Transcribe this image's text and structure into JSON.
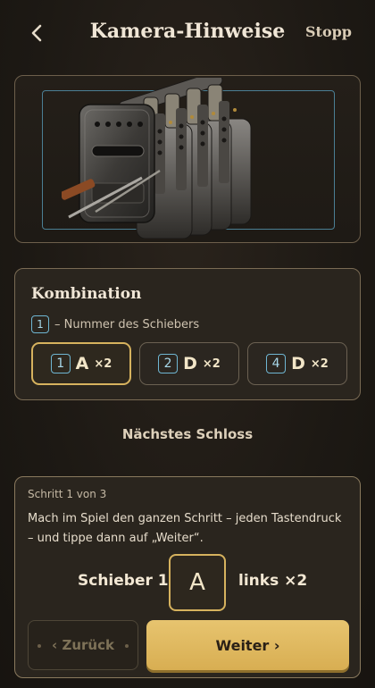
{
  "header": {
    "title": "Kamera-Hinweise",
    "stop_label": "Stopp",
    "back_icon": "chevron-left-icon"
  },
  "camera": {
    "image_subject": "lock-mechanism-image",
    "frame_color": "#4b7f94"
  },
  "combination": {
    "title": "Kombination",
    "legend_number": "1",
    "legend_text": "– Nummer des Schiebers",
    "chips": [
      {
        "number": "1",
        "letter": "A",
        "count": "×2",
        "active": true
      },
      {
        "number": "2",
        "letter": "D",
        "count": "×2",
        "active": false
      },
      {
        "number": "4",
        "letter": "D",
        "count": "×2",
        "active": false
      }
    ]
  },
  "next_lock_label": "Nächstes Schloss",
  "step": {
    "counter": "Schritt 1 von 3",
    "instruction": "Mach im Spiel den ganzen Schritt – jeden Tastendruck – und tippe dann auf „Weiter“.",
    "slider_label": "Schieber 1",
    "key": "A",
    "direction": "links ×2",
    "back_label": "‹ Zurück",
    "next_label": "Weiter ›"
  },
  "colors": {
    "accent_gold": "#d6b25e",
    "number_blue": "#6fb6d2",
    "background": "#1d1914"
  }
}
